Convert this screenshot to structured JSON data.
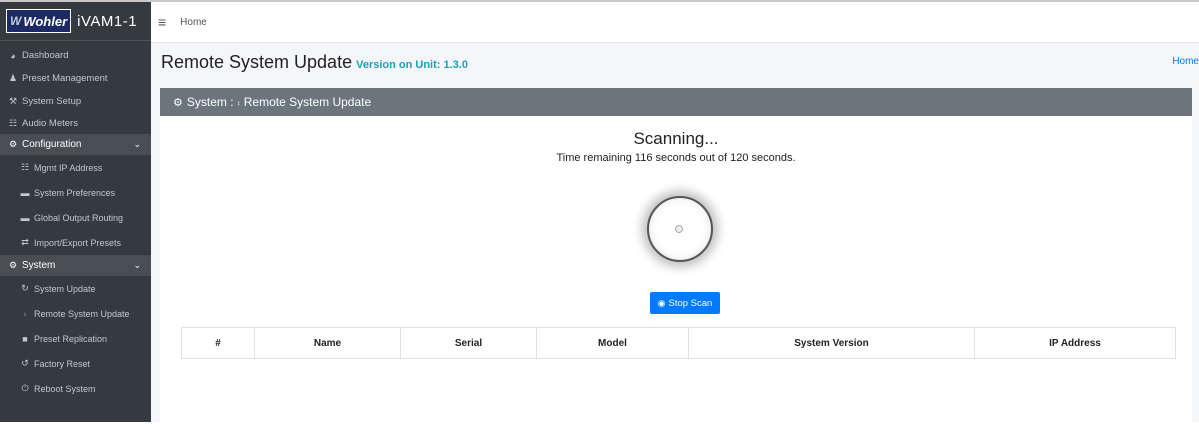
{
  "brand": {
    "logo_text": "Wohler",
    "device_name": "iVAM1-1"
  },
  "sidebar": {
    "items": [
      {
        "label": "Dashboard",
        "icon": "dashboard-icon",
        "glyph": "◕"
      },
      {
        "label": "Preset Management",
        "icon": "user-icon",
        "glyph": "♟"
      },
      {
        "label": "System Setup",
        "icon": "tools-icon",
        "glyph": "⚒"
      },
      {
        "label": "Audio Meters",
        "icon": "chart-icon",
        "glyph": "☷"
      }
    ],
    "configuration": {
      "label": "Configuration",
      "icon": "cog-icon",
      "glyph": "⚙",
      "items": [
        {
          "label": "Mgmt IP Address",
          "icon": "network-icon",
          "glyph": "☷"
        },
        {
          "label": "System Preferences",
          "icon": "keyboard-icon",
          "glyph": "▬"
        },
        {
          "label": "Global Output Routing",
          "icon": "keyboard-icon",
          "glyph": "▬"
        },
        {
          "label": "Import/Export Presets",
          "icon": "exchange-icon",
          "glyph": "⇄"
        }
      ]
    },
    "system": {
      "label": "System",
      "icon": "cogs-icon",
      "glyph": "⚙",
      "items": [
        {
          "label": "System Update",
          "icon": "sync-icon",
          "glyph": "↻"
        },
        {
          "label": "Remote System Update",
          "icon": "network-wired-icon",
          "glyph": "⨾"
        },
        {
          "label": "Preset Replication",
          "icon": "copy-icon",
          "glyph": "■"
        },
        {
          "label": "Factory Reset",
          "icon": "undo-icon",
          "glyph": "↺"
        },
        {
          "label": "Reboot System",
          "icon": "power-icon",
          "glyph": "⏻"
        }
      ]
    }
  },
  "topbar": {
    "home_label": "Home"
  },
  "page": {
    "title": "Remote System Update",
    "version_label": "Version on Unit: 1.3.0",
    "breadcrumb": "Home"
  },
  "card": {
    "header_prefix": "System :",
    "header_title": "Remote System Update",
    "scan_title": "Scanning...",
    "scan_subtitle": "Time remaining 116 seconds out of 120 seconds.",
    "stop_button": "Stop Scan"
  },
  "table": {
    "columns": [
      "#",
      "Name",
      "Serial",
      "Model",
      "System Version",
      "IP Address"
    ]
  },
  "colors": {
    "sidebar_bg": "#343a40",
    "primary": "#007bff",
    "card_header": "#6c757d",
    "version_accent": "#17a2b8"
  }
}
